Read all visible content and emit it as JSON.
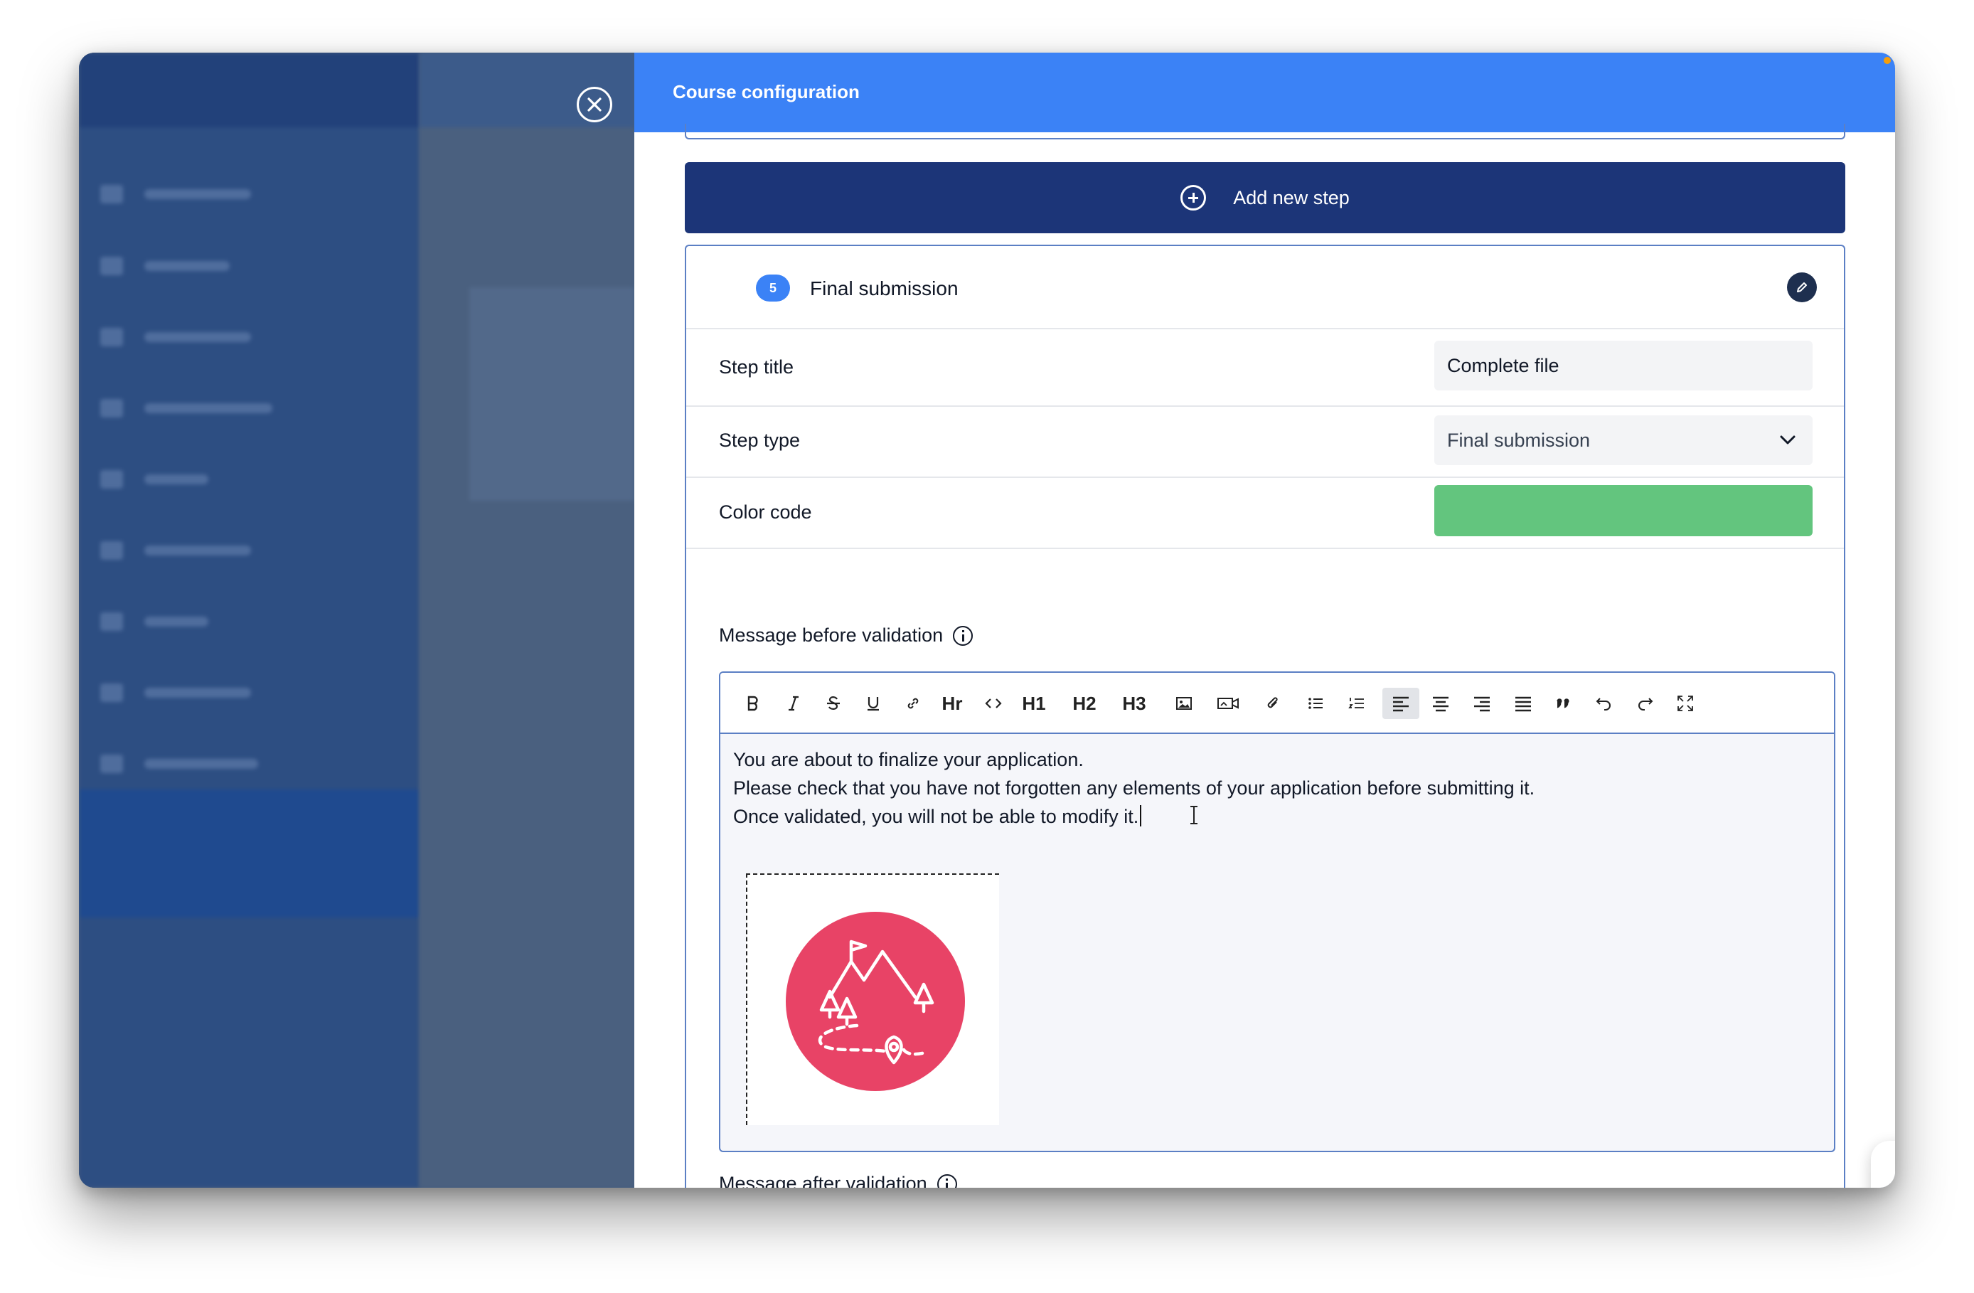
{
  "panel": {
    "title": "Course configuration"
  },
  "add_step": {
    "label": "Add new step"
  },
  "step": {
    "number": "5",
    "name": "Final submission",
    "fields": {
      "title_label": "Step title",
      "title_value": "Complete file",
      "type_label": "Step type",
      "type_value": "Final submission",
      "color_label": "Color code",
      "color_value": "#63c57e"
    },
    "message_before": {
      "label": "Message before validation",
      "lines": [
        "You are about to finalize your application.",
        "Please check that you have not forgotten any elements of your application before submitting it.",
        "Once validated, you will not be able to modify it."
      ]
    },
    "message_after": {
      "label": "Message after validation"
    }
  },
  "toolbar": {
    "hr": "Hr",
    "h1": "H1",
    "h2": "H2",
    "h3": "H3"
  },
  "fab": {
    "emoji": "✌️"
  },
  "colors": {
    "header": "#3b82f6",
    "add_step_bg": "#1c3578",
    "badge": "#3b82f6",
    "logo": "#e84366"
  }
}
